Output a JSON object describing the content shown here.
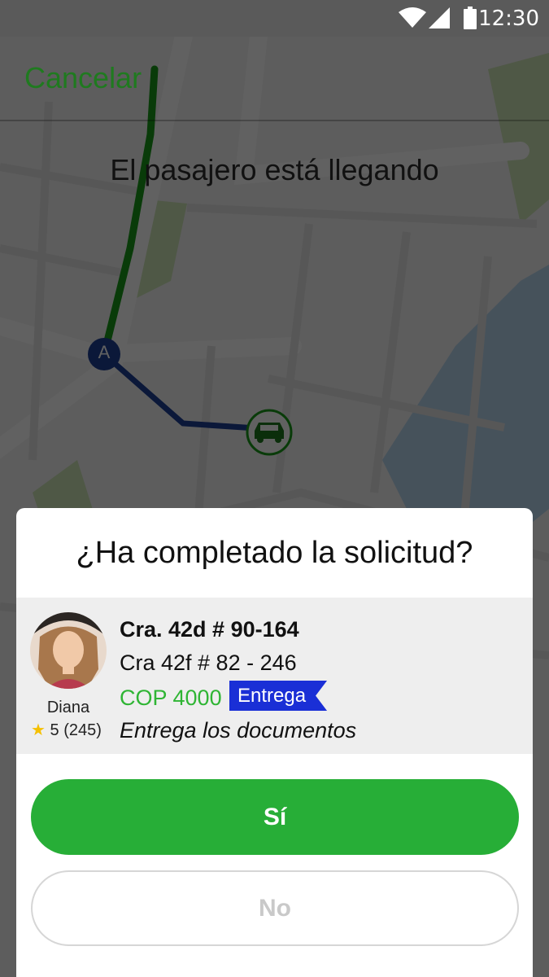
{
  "status_bar": {
    "time": "12:30"
  },
  "header": {
    "cancel_label": "Cancelar"
  },
  "title": "El pasajero está llegando",
  "map": {
    "marker_label": "A"
  },
  "dialog": {
    "question": "¿Ha completado la solicitud?",
    "request": {
      "passenger_name": "Diana",
      "rating_value": "5",
      "rating_count": "(245)",
      "pickup_address": "Cra. 42d # 90-164",
      "dropoff_address": "Cra 42f # 82 - 246",
      "price": "COP 4000",
      "service_tag": "Entrega",
      "note": "Entrega los documentos"
    },
    "yes_label": "Sí",
    "no_label": "No"
  },
  "colors": {
    "primary_green": "#27ae37",
    "price_green": "#2fb534",
    "tag_blue": "#1a2fd6",
    "route_blue": "#1f3f96"
  }
}
